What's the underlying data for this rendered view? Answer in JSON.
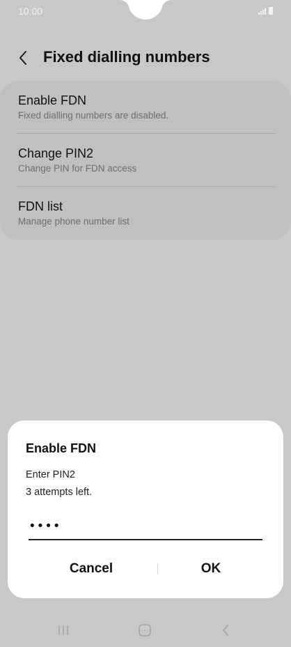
{
  "status_bar": {
    "time": "10:00"
  },
  "header": {
    "title": "Fixed dialling numbers"
  },
  "settings": {
    "items": [
      {
        "title": "Enable FDN",
        "subtitle": "Fixed dialling numbers are disabled."
      },
      {
        "title": "Change PIN2",
        "subtitle": "Change PIN for FDN access"
      },
      {
        "title": "FDN list",
        "subtitle": "Manage phone number list"
      }
    ]
  },
  "dialog": {
    "title": "Enable FDN",
    "message_line1": "Enter PIN2",
    "message_line2": "3 attempts left.",
    "pin_value": "••••",
    "cancel_label": "Cancel",
    "ok_label": "OK"
  },
  "colors": {
    "background": "#c8c8c8",
    "card": "#c0c0c0",
    "dialog": "#ffffff",
    "text": "#111111",
    "subtext": "#6e6e6e"
  },
  "icons": {
    "back": "chevron-left-icon",
    "recents": "recents-icon",
    "home": "home-icon",
    "nav_back": "back-icon"
  }
}
